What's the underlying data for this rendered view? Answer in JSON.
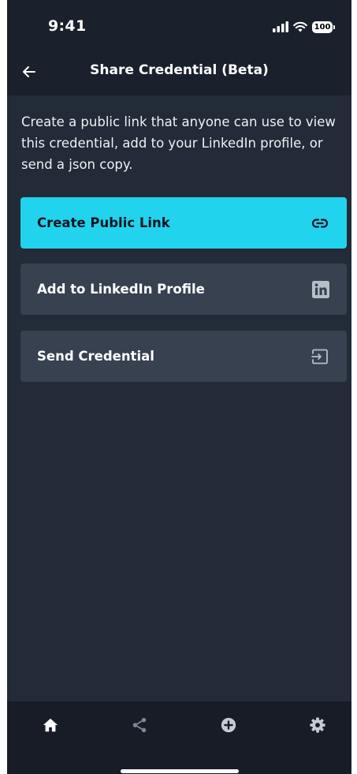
{
  "status_bar": {
    "time": "9:41",
    "battery": "100",
    "icons": [
      "signal-icon",
      "wifi-icon",
      "battery-icon"
    ]
  },
  "header": {
    "title": "Share Credential (Beta)",
    "back_icon": "arrow-left-icon"
  },
  "description": "Create a public link that anyone can use to view this credential, add to your LinkedIn profile, or send a json copy.",
  "actions": [
    {
      "label": "Create Public Link",
      "icon": "link-icon",
      "style": "primary"
    },
    {
      "label": "Add to LinkedIn Profile",
      "icon": "linkedin-icon",
      "style": "secondary"
    },
    {
      "label": "Send Credential",
      "icon": "send-icon",
      "style": "secondary"
    }
  ],
  "bottom_nav": {
    "items": [
      "home-icon",
      "share-icon",
      "plus-circle-icon",
      "gear-icon"
    ]
  },
  "colors": {
    "accent": "#22d3ee",
    "background": "#222b37",
    "header": "#1a202c",
    "button": "#374150",
    "nav": "#171c27"
  }
}
